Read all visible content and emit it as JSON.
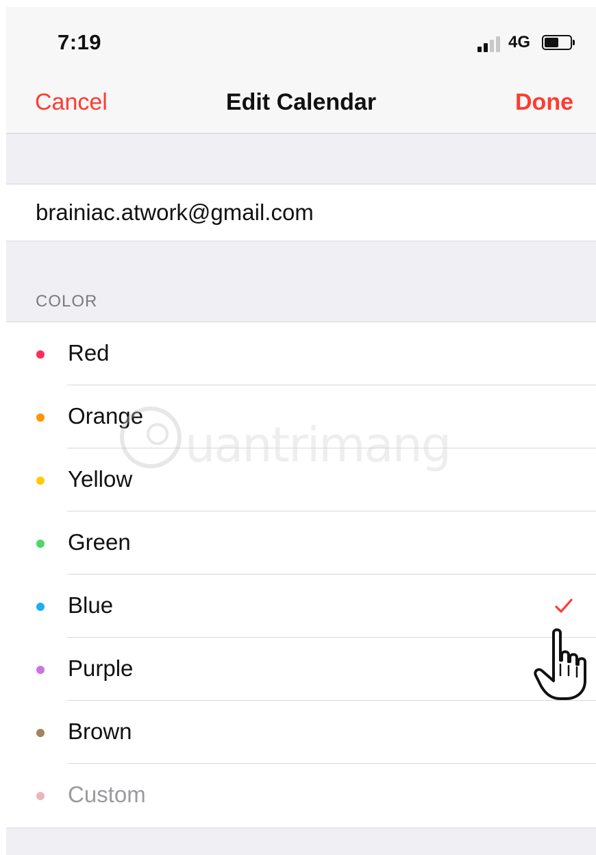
{
  "status_bar": {
    "time": "7:19",
    "network": "4G",
    "signal_bars_filled": 2,
    "signal_bars_total": 4,
    "battery_level": 0.5
  },
  "nav": {
    "cancel": "Cancel",
    "title": "Edit Calendar",
    "done": "Done"
  },
  "account": {
    "email": "brainiac.atwork@gmail.com"
  },
  "color_section": {
    "header": "COLOR",
    "selected": "Blue",
    "items": [
      {
        "label": "Red",
        "color": "#ff2d55",
        "dim": false
      },
      {
        "label": "Orange",
        "color": "#ff9500",
        "dim": false
      },
      {
        "label": "Yellow",
        "color": "#ffcc00",
        "dim": false
      },
      {
        "label": "Green",
        "color": "#4cd964",
        "dim": false
      },
      {
        "label": "Blue",
        "color": "#1badf8",
        "dim": false
      },
      {
        "label": "Purple",
        "color": "#cc73e1",
        "dim": false
      },
      {
        "label": "Brown",
        "color": "#a2845e",
        "dim": false
      },
      {
        "label": "Custom",
        "color": "#e8b7b7",
        "dim": true
      }
    ]
  },
  "colors": {
    "accent": "#ff3b30",
    "background": "#efeff4"
  },
  "icons": {
    "checkmark": "checkmark-icon",
    "cursor": "hand-pointer-icon"
  }
}
